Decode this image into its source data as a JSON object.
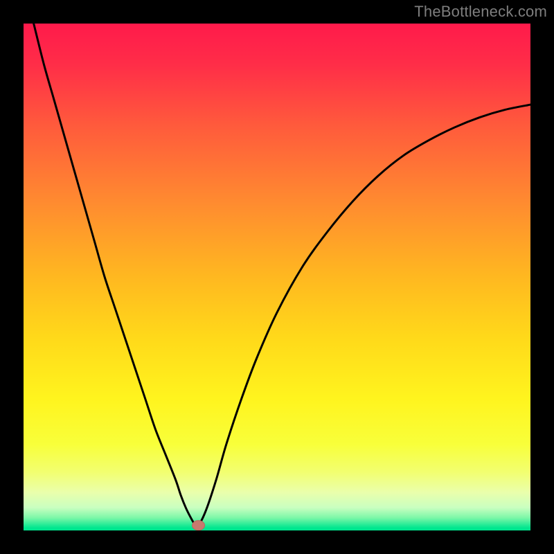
{
  "watermark": "TheBottleneck.com",
  "colors": {
    "frame": "#000000",
    "curve": "#000000",
    "marker_fill": "#c77a6e",
    "marker_stroke": "#b9695d"
  },
  "gradient_stops": [
    {
      "offset": 0.0,
      "color": "#ff1a4b"
    },
    {
      "offset": 0.08,
      "color": "#ff2d48"
    },
    {
      "offset": 0.2,
      "color": "#ff5a3c"
    },
    {
      "offset": 0.35,
      "color": "#ff8a30"
    },
    {
      "offset": 0.5,
      "color": "#ffb820"
    },
    {
      "offset": 0.62,
      "color": "#ffd91a"
    },
    {
      "offset": 0.74,
      "color": "#fff41e"
    },
    {
      "offset": 0.83,
      "color": "#f8ff3a"
    },
    {
      "offset": 0.885,
      "color": "#f2ff70"
    },
    {
      "offset": 0.925,
      "color": "#eaffac"
    },
    {
      "offset": 0.955,
      "color": "#c9ffc0"
    },
    {
      "offset": 0.975,
      "color": "#7cf7a8"
    },
    {
      "offset": 0.995,
      "color": "#00e68f"
    },
    {
      "offset": 1.0,
      "color": "#00e68f"
    }
  ],
  "chart_data": {
    "type": "line",
    "title": "",
    "xlabel": "",
    "ylabel": "",
    "xlim": [
      0,
      100
    ],
    "ylim": [
      0,
      100
    ],
    "series": [
      {
        "name": "bottleneck-curve",
        "x": [
          0,
          2,
          4,
          6,
          8,
          10,
          12,
          14,
          16,
          18,
          20,
          22,
          24,
          26,
          28,
          30,
          31,
          32,
          33,
          33.8,
          34.5,
          36,
          38,
          40,
          43,
          46,
          50,
          55,
          60,
          65,
          70,
          75,
          80,
          85,
          90,
          95,
          100
        ],
        "values": [
          108,
          100,
          92,
          85,
          78,
          71,
          64,
          57,
          50,
          44,
          38,
          32,
          26,
          20,
          15,
          10,
          7,
          4.5,
          2.5,
          1.2,
          1.0,
          4,
          10,
          17,
          26,
          34,
          43,
          52,
          59,
          65,
          70,
          74,
          77,
          79.5,
          81.5,
          83,
          84
        ]
      }
    ],
    "annotations": [
      {
        "name": "minimum-marker",
        "x": 34.5,
        "y": 1.0
      }
    ]
  }
}
